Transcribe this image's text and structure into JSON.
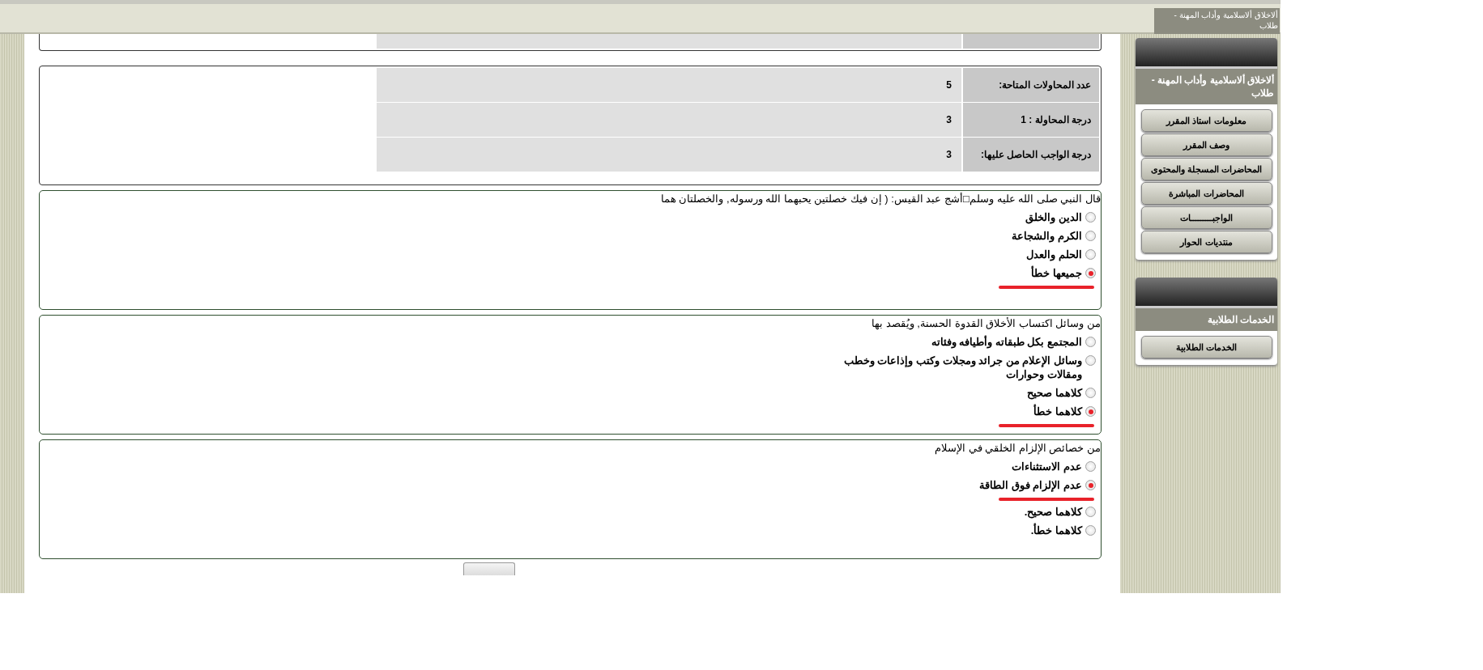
{
  "header": {
    "title": "ألاخلاق ألاسلامية وأداب المهنة - طلاب"
  },
  "attempts": [
    {
      "label": "عدد المحاولات المتاحة:",
      "value": "5"
    },
    {
      "label": "درجة المحاولة : 1",
      "value": "3"
    },
    {
      "label": "درجة الواجب الحاصل عليها:",
      "value": "3"
    }
  ],
  "questions": [
    {
      "text": "قال النبي صلى الله عليه وسلم□أشج عبد القيس: ( إن فيك خصلتين يحبهما الله ورسوله, والخصلتان هما",
      "options": [
        {
          "label": "الدين والخلق",
          "selected": false,
          "underlined": false
        },
        {
          "label": "الكرم والشجاعة",
          "selected": false,
          "underlined": false
        },
        {
          "label": "الحلم والعدل",
          "selected": false,
          "underlined": false
        },
        {
          "label": "جميعها خطأ",
          "selected": true,
          "underlined": true
        }
      ]
    },
    {
      "text": "من وسائل اكتساب الأخلاق القدوة الحسنة, ويُقصد بها",
      "options": [
        {
          "label": "المجتمع بكل طبقاته وأطيافه وفئاته",
          "selected": false,
          "underlined": false
        },
        {
          "label": "وسائل الإعلام من جرائد ومجلات وكتب وإذاعات وخطب ومقالات وحوارات",
          "selected": false,
          "underlined": false
        },
        {
          "label": "كلاهما صحيح",
          "selected": false,
          "underlined": false
        },
        {
          "label": "كلاهما خطأ",
          "selected": true,
          "underlined": true
        }
      ]
    },
    {
      "text": "من خصائص الإلزام الخلقي في الإسلام",
      "options": [
        {
          "label": "عدم الاستثناءات",
          "selected": false,
          "underlined": false
        },
        {
          "label": "عدم الإلزام فوق الطاقة",
          "selected": true,
          "underlined": true
        },
        {
          "label": "كلاهما صحيح.",
          "selected": false,
          "underlined": false
        },
        {
          "label": "كلاهما خطأ.",
          "selected": false,
          "underlined": false
        }
      ]
    }
  ],
  "sidebar": {
    "panels": [
      {
        "title": "ألاخلاق ألاسلامية وأداب المهنة - طلاب",
        "items": [
          "معلومات استاذ المقرر",
          "وصف المقرر",
          "المحاضرات المسجلة والمحتوى",
          "المحاضرات المباشرة",
          "الواجبـــــــــات",
          "منتديات الحوار"
        ]
      },
      {
        "title": "الخدمات الطلابية",
        "items": [
          "الخدمات الطلابية"
        ]
      }
    ]
  }
}
